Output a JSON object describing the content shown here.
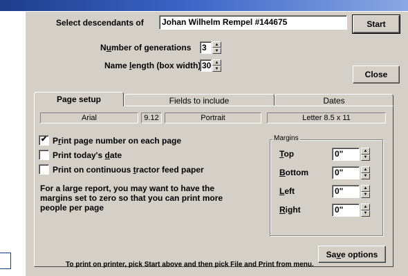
{
  "window": {
    "select_label": "Select descendants of",
    "select_value": "Johan Wilhelm Rempel  #144675",
    "start_label": "Start",
    "close_label": "Close",
    "generations_label_pre": "N",
    "generations_label_u": "u",
    "generations_label_post": "mber of generations",
    "generations_value": "3",
    "namelength_label_pre": "Name ",
    "namelength_label_u": "l",
    "namelength_label_post": "ength (box width)",
    "namelength_value": "30"
  },
  "tabs": [
    {
      "label": "Page setup",
      "active": true
    },
    {
      "label": "Fields to include",
      "active": false
    },
    {
      "label": "Dates",
      "active": false
    }
  ],
  "page_setup": {
    "font_name": "Arial",
    "font_size": "9.12",
    "orientation": "Portrait",
    "paper": "Letter 8.5 x 11",
    "checkboxes": [
      {
        "pre": "P",
        "u": "r",
        "post": "int page number on each page",
        "checked": true
      },
      {
        "pre": "Print today's ",
        "u": "d",
        "post": "ate",
        "checked": false
      },
      {
        "pre": "Print on continuous ",
        "u": "t",
        "post": "ractor feed paper",
        "checked": false
      }
    ],
    "check_mark": "✔",
    "note": "For a large report, you may want to have the margins set to zero so that you can print more people per page",
    "margins": {
      "title": "Margins",
      "rows": [
        {
          "u": "T",
          "post": "op",
          "value": "0\""
        },
        {
          "u": "B",
          "post": "ottom",
          "value": "0\""
        },
        {
          "u": "L",
          "post": "eft",
          "value": "0\""
        },
        {
          "u": "R",
          "post": "ight",
          "value": "0\""
        }
      ]
    },
    "save_pre": "Sa",
    "save_u": "v",
    "save_post": "e options"
  },
  "footer": "To print on printer, pick Start above and then pick File and Print from menu.",
  "icons": {
    "spin_up": "▲",
    "spin_down": "▼"
  }
}
